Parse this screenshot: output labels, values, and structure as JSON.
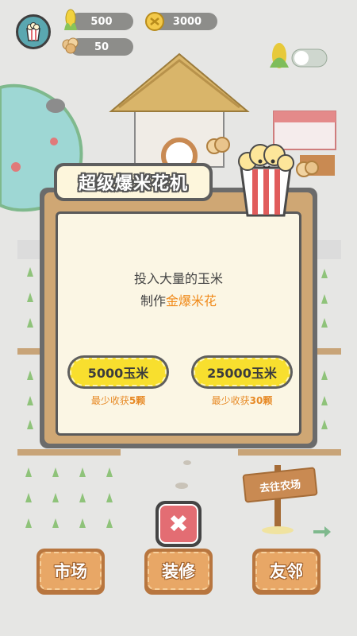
{
  "resources": {
    "corn": "500",
    "gold_coin": "3000",
    "popcorn": "50"
  },
  "modal": {
    "title": "超级爆米花机",
    "desc_line1": "投入大量的玉米",
    "desc_line2_prefix": "制作",
    "desc_line2_highlight": "金爆米花",
    "option1": {
      "label": "5000玉米",
      "min_prefix": "最少收获",
      "min_value": "5颗"
    },
    "option2": {
      "label": "25000玉米",
      "min_prefix": "最少收获",
      "min_value": "30颗"
    },
    "close_symbol": "✖"
  },
  "sign": {
    "label": "去往农场"
  },
  "bottom_nav": {
    "market": "市场",
    "decorate": "装修",
    "friends": "友邻"
  },
  "colors": {
    "accent_orange": "#f08a1a",
    "button_yellow": "#f8df2e",
    "close_red": "#e36d73",
    "nav_button": "#e8a766"
  }
}
